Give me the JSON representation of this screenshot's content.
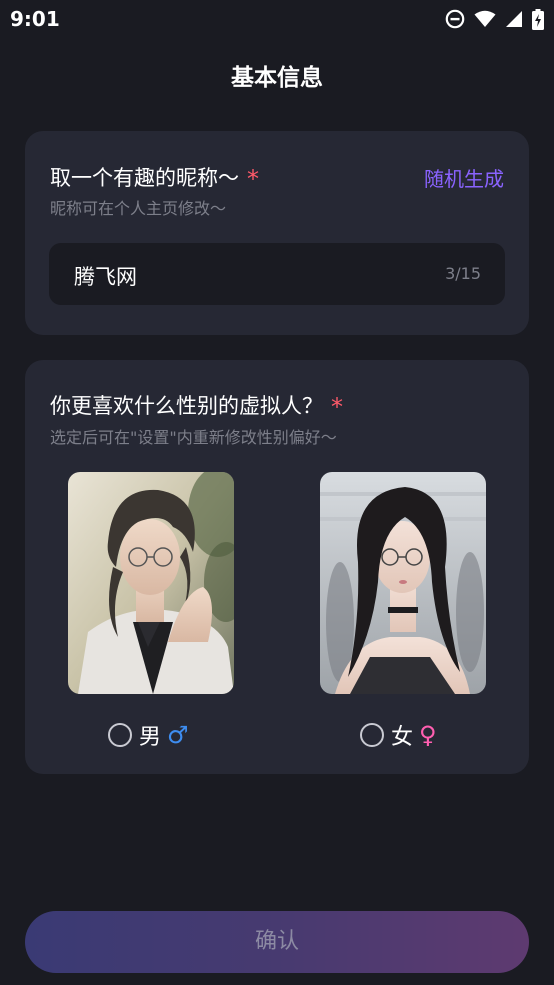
{
  "status_bar": {
    "time": "9:01",
    "icons": [
      "do-not-disturb-icon",
      "wifi-icon",
      "cellular-signal-icon",
      "battery-charging-icon"
    ]
  },
  "header": {
    "title": "基本信息"
  },
  "nickname_card": {
    "title": "取一个有趣的昵称～",
    "required_mark": "*",
    "subtitle": "昵称可在个人主页修改～",
    "random_button": "随机生成",
    "input_value": "腾飞网",
    "char_count": "3/15"
  },
  "gender_card": {
    "title": "你更喜欢什么性别的虚拟人？",
    "required_mark": "*",
    "subtitle": "选定后可在\"设置\"内重新修改性别偏好～",
    "options": [
      {
        "label": "男",
        "symbol": "♂",
        "selected": false
      },
      {
        "label": "女",
        "symbol": "♀",
        "selected": false
      }
    ]
  },
  "footer": {
    "confirm_button": "确认"
  },
  "colors": {
    "background": "#1a1b22",
    "card": "#262834",
    "accent_purple": "#8a63ff",
    "required_red": "#ff5a6a",
    "male_blue": "#3e8df0",
    "female_pink": "#ff5fb1"
  }
}
